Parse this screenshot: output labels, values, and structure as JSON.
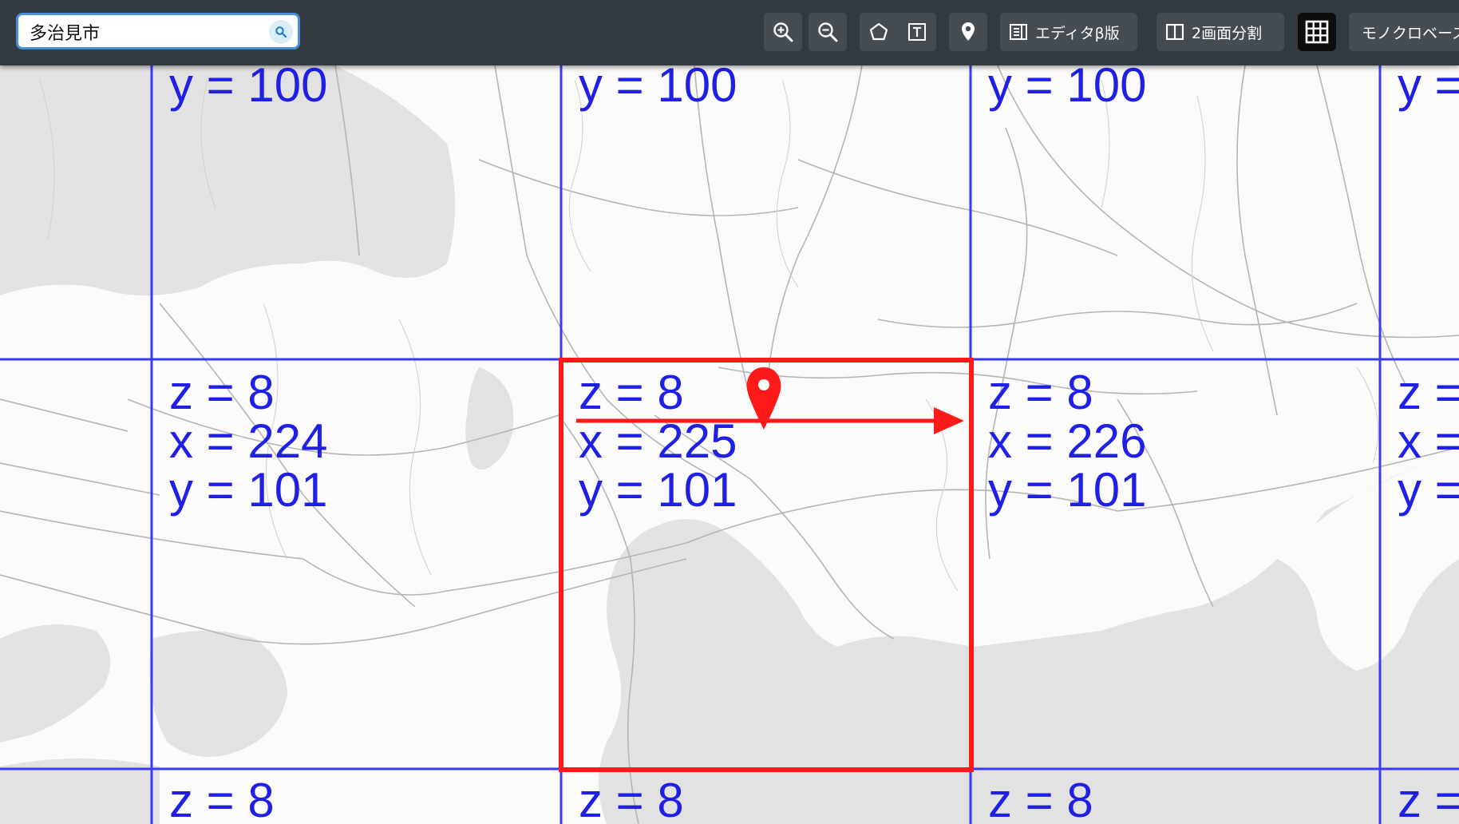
{
  "search": {
    "value": "多治見市",
    "placeholder": "",
    "icon": "search-icon"
  },
  "toolbar": {
    "zoom_in_icon": "zoom-in-icon",
    "zoom_out_icon": "zoom-out-icon",
    "polygon_icon": "polygon-icon",
    "text_icon": "text-icon",
    "pin_icon": "map-pin-icon",
    "editor_label": "エディタβ版",
    "split_label": "2画面分割",
    "grid_icon": "grid-icon",
    "mono_label": "モノクロベース"
  },
  "tiles": {
    "top_row": [
      "y = 100",
      "y = 100",
      "y = 100",
      "y ="
    ],
    "middle_row": [
      "z = 8\nx = 224\ny = 101",
      "z = 8\nx = 225\ny = 101",
      "z = 8\nx = 226\ny = 101",
      "z =\nx =\ny ="
    ],
    "bottom_row": [
      "z = 8",
      "z = 8",
      "z = 8",
      "z ="
    ]
  },
  "colors": {
    "toolbar_bg": "#343b40",
    "grid_line": "#3a3aff",
    "tile_label": "#1f1fe6",
    "highlight": "#ff1a1a",
    "water": "#e2e2e2",
    "land": "#fbfbfb"
  }
}
